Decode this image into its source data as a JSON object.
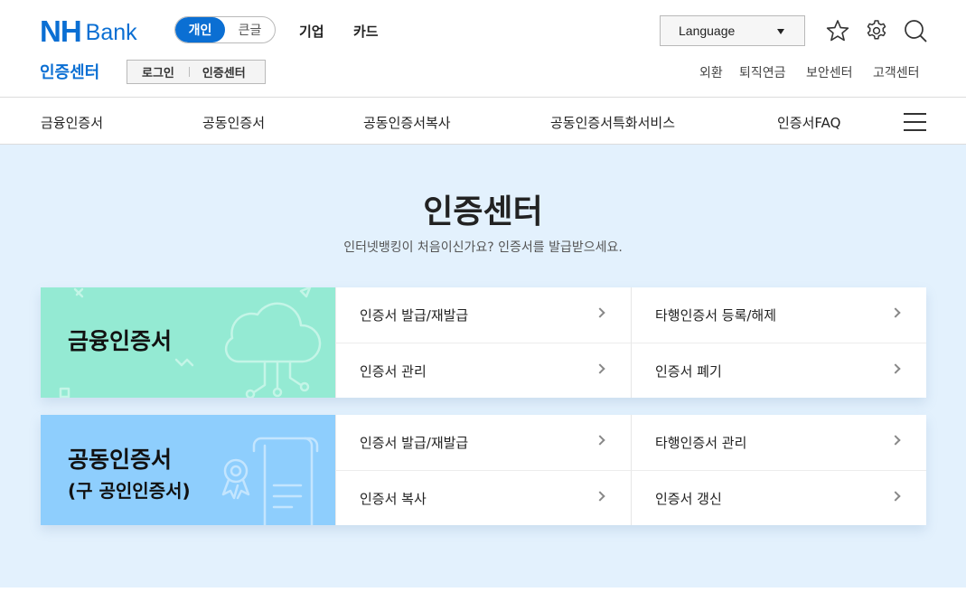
{
  "header": {
    "logo_nh": "NH",
    "logo_bank": "Bank",
    "segment": [
      "개인",
      "큰글"
    ],
    "topnav": [
      "기업",
      "카드"
    ],
    "language": "Language",
    "section_title": "인증센터",
    "sub_buttons": [
      "로그인",
      "인증센터"
    ],
    "util_links": [
      "외환",
      "퇴직연금",
      "보안센터",
      "고객센터"
    ]
  },
  "mainnav": {
    "items": [
      "금융인증서",
      "공동인증서",
      "공동인증서복사",
      "공동인증서특화서비스",
      "인증서FAQ"
    ]
  },
  "hero": {
    "title": "인증센터",
    "subtitle": "인터넷뱅킹이 처음이신가요? 인증서를 발급받으세요."
  },
  "cards": [
    {
      "name": "금융인증서",
      "sub": "",
      "accent": "#94ead3",
      "items": [
        "인증서 발급/재발급",
        "타행인증서 등록/해제",
        "인증서 관리",
        "인증서 폐기"
      ]
    },
    {
      "name": "공동인증서",
      "sub": "(구 공인인증서)",
      "accent": "#8ecefd",
      "items": [
        "인증서 발급/재발급",
        "타행인증서 관리",
        "인증서 복사",
        "인증서 갱신"
      ]
    }
  ],
  "icons": [
    "star-icon",
    "gear-icon",
    "search-icon",
    "hamburger-icon",
    "chevron-right-icon"
  ]
}
